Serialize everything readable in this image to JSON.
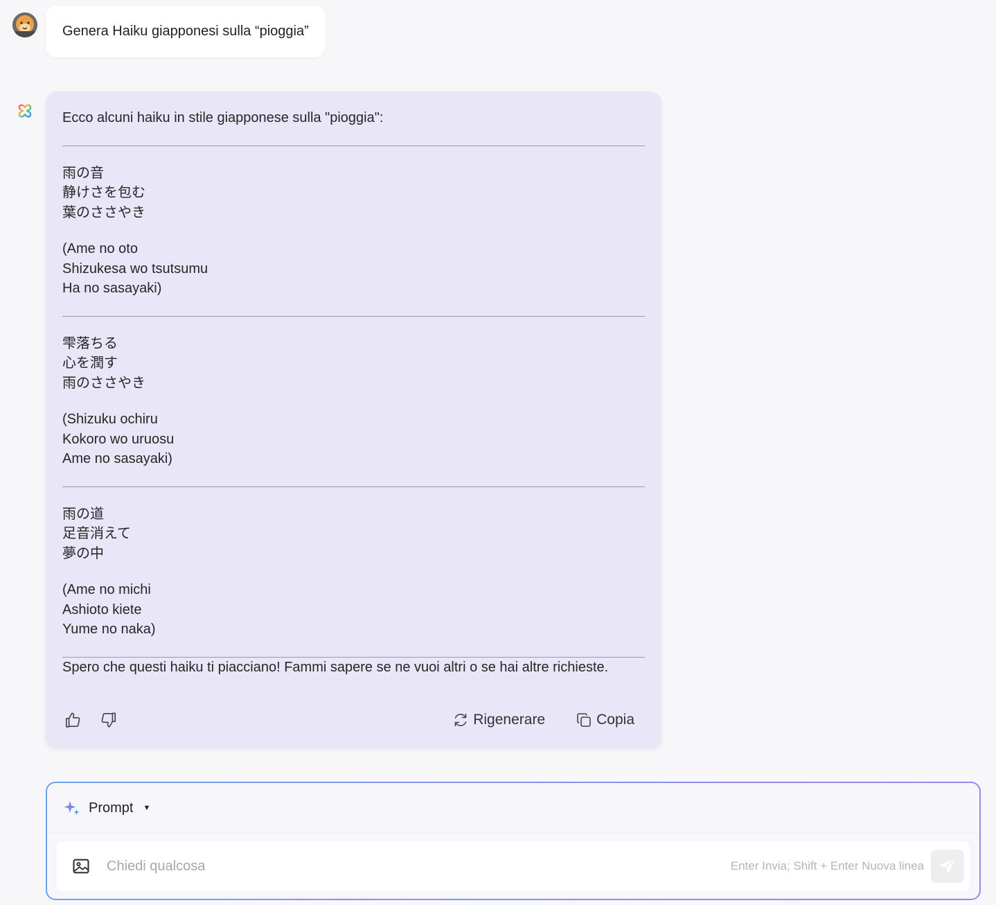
{
  "user_message": {
    "text": "Genera Haiku giapponesi sulla “pioggia”"
  },
  "assistant_message": {
    "intro": "Ecco alcuni haiku in stile giapponese sulla \"pioggia\":",
    "haikus": [
      {
        "japanese": [
          "雨の音",
          "静けさを包む",
          "葉のささやき"
        ],
        "romaji": [
          "(Ame no oto",
          "Shizukesa wo tsutsumu",
          "Ha no sasayaki)"
        ]
      },
      {
        "japanese": [
          "雫落ちる",
          "心を潤す",
          "雨のささやき"
        ],
        "romaji": [
          "(Shizuku ochiru",
          "Kokoro wo uruosu",
          "Ame no sasayaki)"
        ]
      },
      {
        "japanese": [
          "雨の道",
          "足音消えて",
          "夢の中"
        ],
        "romaji": [
          "(Ame no michi",
          "Ashioto kiete",
          "Yume no naka)"
        ]
      }
    ],
    "closing": "Spero che questi haiku ti piacciano! Fammi sapere se ne vuoi altri o se hai altre richieste.",
    "actions": {
      "regenerate_label": "Rigenerare",
      "copy_label": "Copia"
    }
  },
  "composer": {
    "mode_label": "Prompt",
    "placeholder": "Chiedi qualcosa",
    "value": "",
    "hint": "Enter Invia; Shift + Enter Nuova linea"
  },
  "colors": {
    "assistant_bubble": "#e9e6f8",
    "page_background": "#f7f7f9",
    "composer_border_start": "#6ea2e8",
    "composer_border_end": "#9a86e6"
  },
  "icons": {
    "user_avatar": "cartoon-character-avatar",
    "bot_logo": "multicolor-clover-logo",
    "like": "thumbs-up-icon",
    "dislike": "thumbs-down-icon",
    "regenerate": "refresh-icon",
    "copy": "copy-icon",
    "mode": "sparkle-icon",
    "image": "image-icon",
    "send": "send-icon"
  }
}
